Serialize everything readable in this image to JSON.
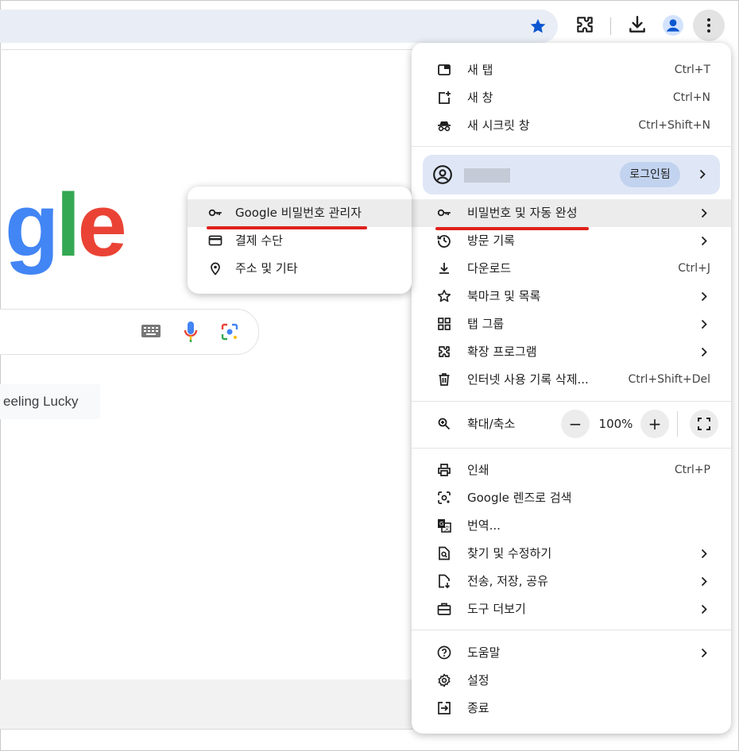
{
  "toolbar": {
    "icons": [
      "star-icon",
      "extensions-icon",
      "download-icon",
      "profile-icon",
      "more-icon"
    ]
  },
  "page": {
    "logo_letters": [
      {
        "ch": "g",
        "color": "#4285f4"
      },
      {
        "ch": "l",
        "color": "#34a853"
      },
      {
        "ch": "e",
        "color": "#ea4335"
      }
    ],
    "lucky_label": "eeling Lucky"
  },
  "menu": {
    "group1": [
      {
        "label": "새 탭",
        "shortcut": "Ctrl+T",
        "icon": "new-tab-icon"
      },
      {
        "label": "새 창",
        "shortcut": "Ctrl+N",
        "icon": "new-window-icon"
      },
      {
        "label": "새 시크릿 창",
        "shortcut": "Ctrl+Shift+N",
        "icon": "incognito-icon"
      }
    ],
    "profile": {
      "login_label": "로그인됨"
    },
    "group2": [
      {
        "label": "비밀번호 및 자동 완성",
        "icon": "key-icon"
      },
      {
        "label": "방문 기록",
        "icon": "history-icon"
      },
      {
        "label": "다운로드",
        "shortcut": "Ctrl+J",
        "icon": "download-icon"
      },
      {
        "label": "북마크 및 목록",
        "icon": "star-outline-icon"
      },
      {
        "label": "탭 그룹",
        "icon": "tab-groups-icon"
      },
      {
        "label": "확장 프로그램",
        "icon": "extensions-icon"
      },
      {
        "label": "인터넷 사용 기록 삭제...",
        "shortcut": "Ctrl+Shift+Del",
        "icon": "trash-icon"
      }
    ],
    "zoom": {
      "label": "확대/축소",
      "minus": "−",
      "value": "100%",
      "plus": "+"
    },
    "group3": [
      {
        "label": "인쇄",
        "shortcut": "Ctrl+P",
        "icon": "print-icon"
      },
      {
        "label": "Google 렌즈로 검색",
        "icon": "lens-icon"
      },
      {
        "label": "번역...",
        "icon": "translate-icon"
      },
      {
        "label": "찾기 및 수정하기",
        "icon": "find-icon"
      },
      {
        "label": "전송, 저장, 공유",
        "icon": "share-icon"
      },
      {
        "label": "도구 더보기",
        "icon": "toolbox-icon"
      }
    ],
    "group4": [
      {
        "label": "도움말",
        "icon": "help-icon"
      },
      {
        "label": "설정",
        "icon": "settings-icon"
      },
      {
        "label": "종료",
        "icon": "exit-icon"
      }
    ]
  },
  "submenu": {
    "items": [
      {
        "label": "Google 비밀번호 관리자",
        "icon": "key-icon"
      },
      {
        "label": "결제 수단",
        "icon": "credit-card-icon"
      },
      {
        "label": "주소 및 기타",
        "icon": "location-pin-icon"
      }
    ]
  },
  "colors": {
    "accent": "#0b57d0",
    "highlight_underline": "#e0211b"
  }
}
